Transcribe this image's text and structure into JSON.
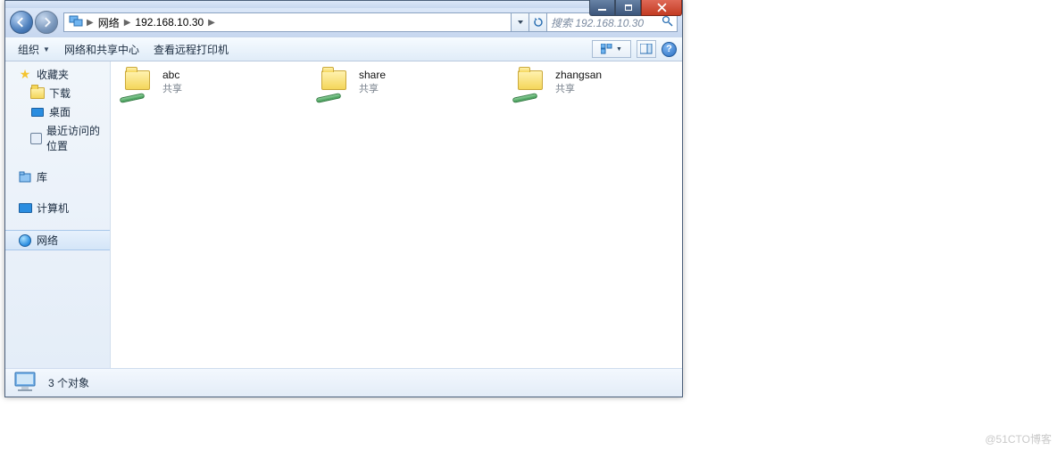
{
  "window": {
    "controls": {
      "min": "min",
      "max": "max",
      "close": "close"
    }
  },
  "address": {
    "root_label": "网络",
    "path_label": "192.168.10.30"
  },
  "search": {
    "placeholder": "搜索 192.168.10.30"
  },
  "toolbar": {
    "organize": "组织",
    "network_center": "网络和共享中心",
    "view_printers": "查看远程打印机",
    "help": "?"
  },
  "sidebar": {
    "favorites": {
      "label": "收藏夹",
      "items": [
        {
          "label": "下载"
        },
        {
          "label": "桌面"
        },
        {
          "label": "最近访问的位置"
        }
      ]
    },
    "libraries": {
      "label": "库"
    },
    "computer": {
      "label": "计算机"
    },
    "network": {
      "label": "网络"
    }
  },
  "content": {
    "shares": [
      {
        "name": "abc",
        "subtitle": "共享"
      },
      {
        "name": "share",
        "subtitle": "共享"
      },
      {
        "name": "zhangsan",
        "subtitle": "共享"
      }
    ]
  },
  "status": {
    "text": "3 个对象"
  },
  "watermark": "@51CTO博客"
}
